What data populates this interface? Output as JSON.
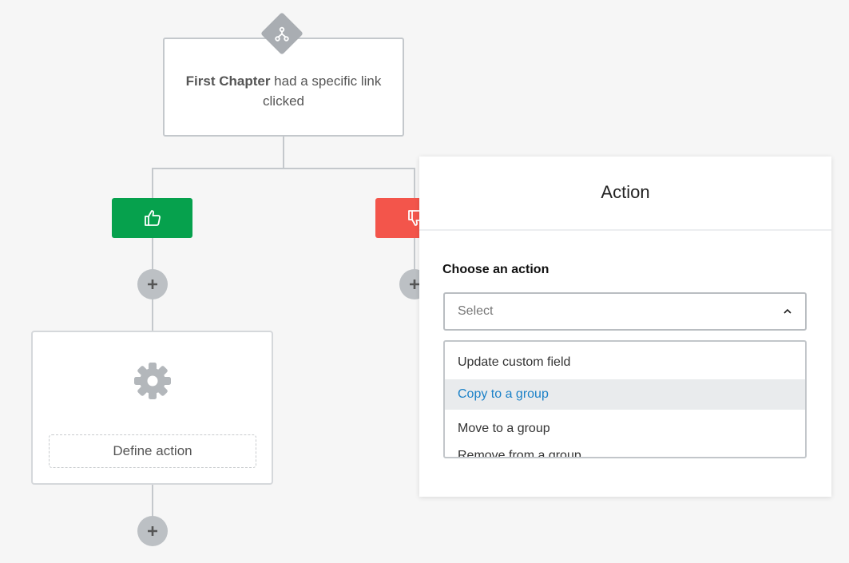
{
  "trigger_node": {
    "name": "First Chapter",
    "condition_text": "had a specific link clicked",
    "icon": "split-branch-icon"
  },
  "branches": {
    "yes": {
      "icon": "thumbs-up-icon",
      "color": "#06a14d"
    },
    "no": {
      "icon": "thumbs-down-icon",
      "color": "#f3554b"
    }
  },
  "action_card": {
    "icon": "gear-icon",
    "define_label": "Define action"
  },
  "panel": {
    "title": "Action",
    "choose_label": "Choose an action",
    "select_placeholder": "Select",
    "options": [
      {
        "label": "Update custom field",
        "highlighted": false
      },
      {
        "label": "Copy to a group",
        "highlighted": true
      },
      {
        "label": "Move to a group",
        "highlighted": false
      },
      {
        "label": "Remove from a group",
        "highlighted": false
      }
    ]
  },
  "colors": {
    "background": "#f6f6f6",
    "connector": "#c4c8cc",
    "link_blue": "#1d82c8"
  }
}
